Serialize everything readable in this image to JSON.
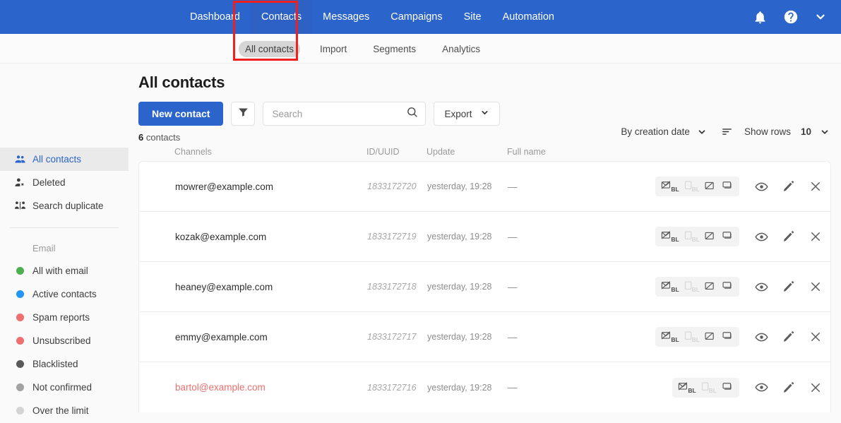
{
  "topnav": {
    "items": [
      {
        "label": "Dashboard",
        "active": false
      },
      {
        "label": "Contacts",
        "active": true
      },
      {
        "label": "Messages",
        "active": false
      },
      {
        "label": "Campaigns",
        "active": false
      },
      {
        "label": "Site",
        "active": false
      },
      {
        "label": "Automation",
        "active": false
      }
    ],
    "icons": [
      "bell-icon",
      "help-icon",
      "chevron-down-icon"
    ]
  },
  "subnav": {
    "items": [
      {
        "label": "All contacts",
        "active": true
      },
      {
        "label": "Import",
        "active": false
      },
      {
        "label": "Segments",
        "active": false
      },
      {
        "label": "Analytics",
        "active": false
      }
    ]
  },
  "annotation": {
    "color": "#f02020",
    "target": "Contacts / All contacts"
  },
  "sidebar": {
    "nav": [
      {
        "label": "All contacts",
        "icon": "people-icon",
        "active": true
      },
      {
        "label": "Deleted",
        "icon": "person-remove-icon",
        "active": false
      },
      {
        "label": "Search duplicate",
        "icon": "duplicate-people-icon",
        "active": false
      }
    ],
    "group_label": "Email",
    "filters": [
      {
        "label": "All with email",
        "color": "#4caf50"
      },
      {
        "label": "Active contacts",
        "color": "#2196f3"
      },
      {
        "label": "Spam reports",
        "color": "#ef6e6e"
      },
      {
        "label": "Unsubscribed",
        "color": "#ef6e6e"
      },
      {
        "label": "Blacklisted",
        "color": "#5a5a5a"
      },
      {
        "label": "Not confirmed",
        "color": "#a3a3a3"
      },
      {
        "label": "Over the limit",
        "color": "#d4d4d4"
      }
    ]
  },
  "main": {
    "title": "All contacts",
    "new_contact_label": "New contact",
    "filter_icon": "funnel-icon",
    "search": {
      "value": "",
      "placeholder": "Search",
      "icon": "search-icon"
    },
    "export_label": "Export",
    "count_number": "6",
    "count_label": "contacts",
    "sort_label": "By creation date",
    "sort_direction_icon": "sort-icon",
    "show_rows_label": "Show rows",
    "show_rows_value": "10",
    "columns": [
      "Channels",
      "ID/UUID",
      "Update",
      "Full name"
    ],
    "rows": [
      {
        "email": "mowrer@example.com",
        "id": "1833172720",
        "update": "yesterday, 19:28",
        "fullname": "—",
        "warn": false,
        "channel_icons": 4
      },
      {
        "email": "kozak@example.com",
        "id": "1833172719",
        "update": "yesterday, 19:28",
        "fullname": "—",
        "warn": false,
        "channel_icons": 4
      },
      {
        "email": "heaney@example.com",
        "id": "1833172718",
        "update": "yesterday, 19:28",
        "fullname": "—",
        "warn": false,
        "channel_icons": 4
      },
      {
        "email": "emmy@example.com",
        "id": "1833172717",
        "update": "yesterday, 19:28",
        "fullname": "—",
        "warn": false,
        "channel_icons": 4
      },
      {
        "email": "bartol@example.com",
        "id": "1833172716",
        "update": "yesterday, 19:28",
        "fullname": "—",
        "warn": true,
        "channel_icons": 3
      }
    ],
    "row_action_icons": [
      "view-icon",
      "edit-icon",
      "delete-icon"
    ],
    "channel_icons": [
      "email-blacklist-icon",
      "sms-blacklist-icon",
      "push-icon",
      "chat-icon"
    ]
  },
  "colors": {
    "brand": "#2b65cc",
    "warn": "#ef6e6e",
    "page_bg": "#fafafa"
  }
}
